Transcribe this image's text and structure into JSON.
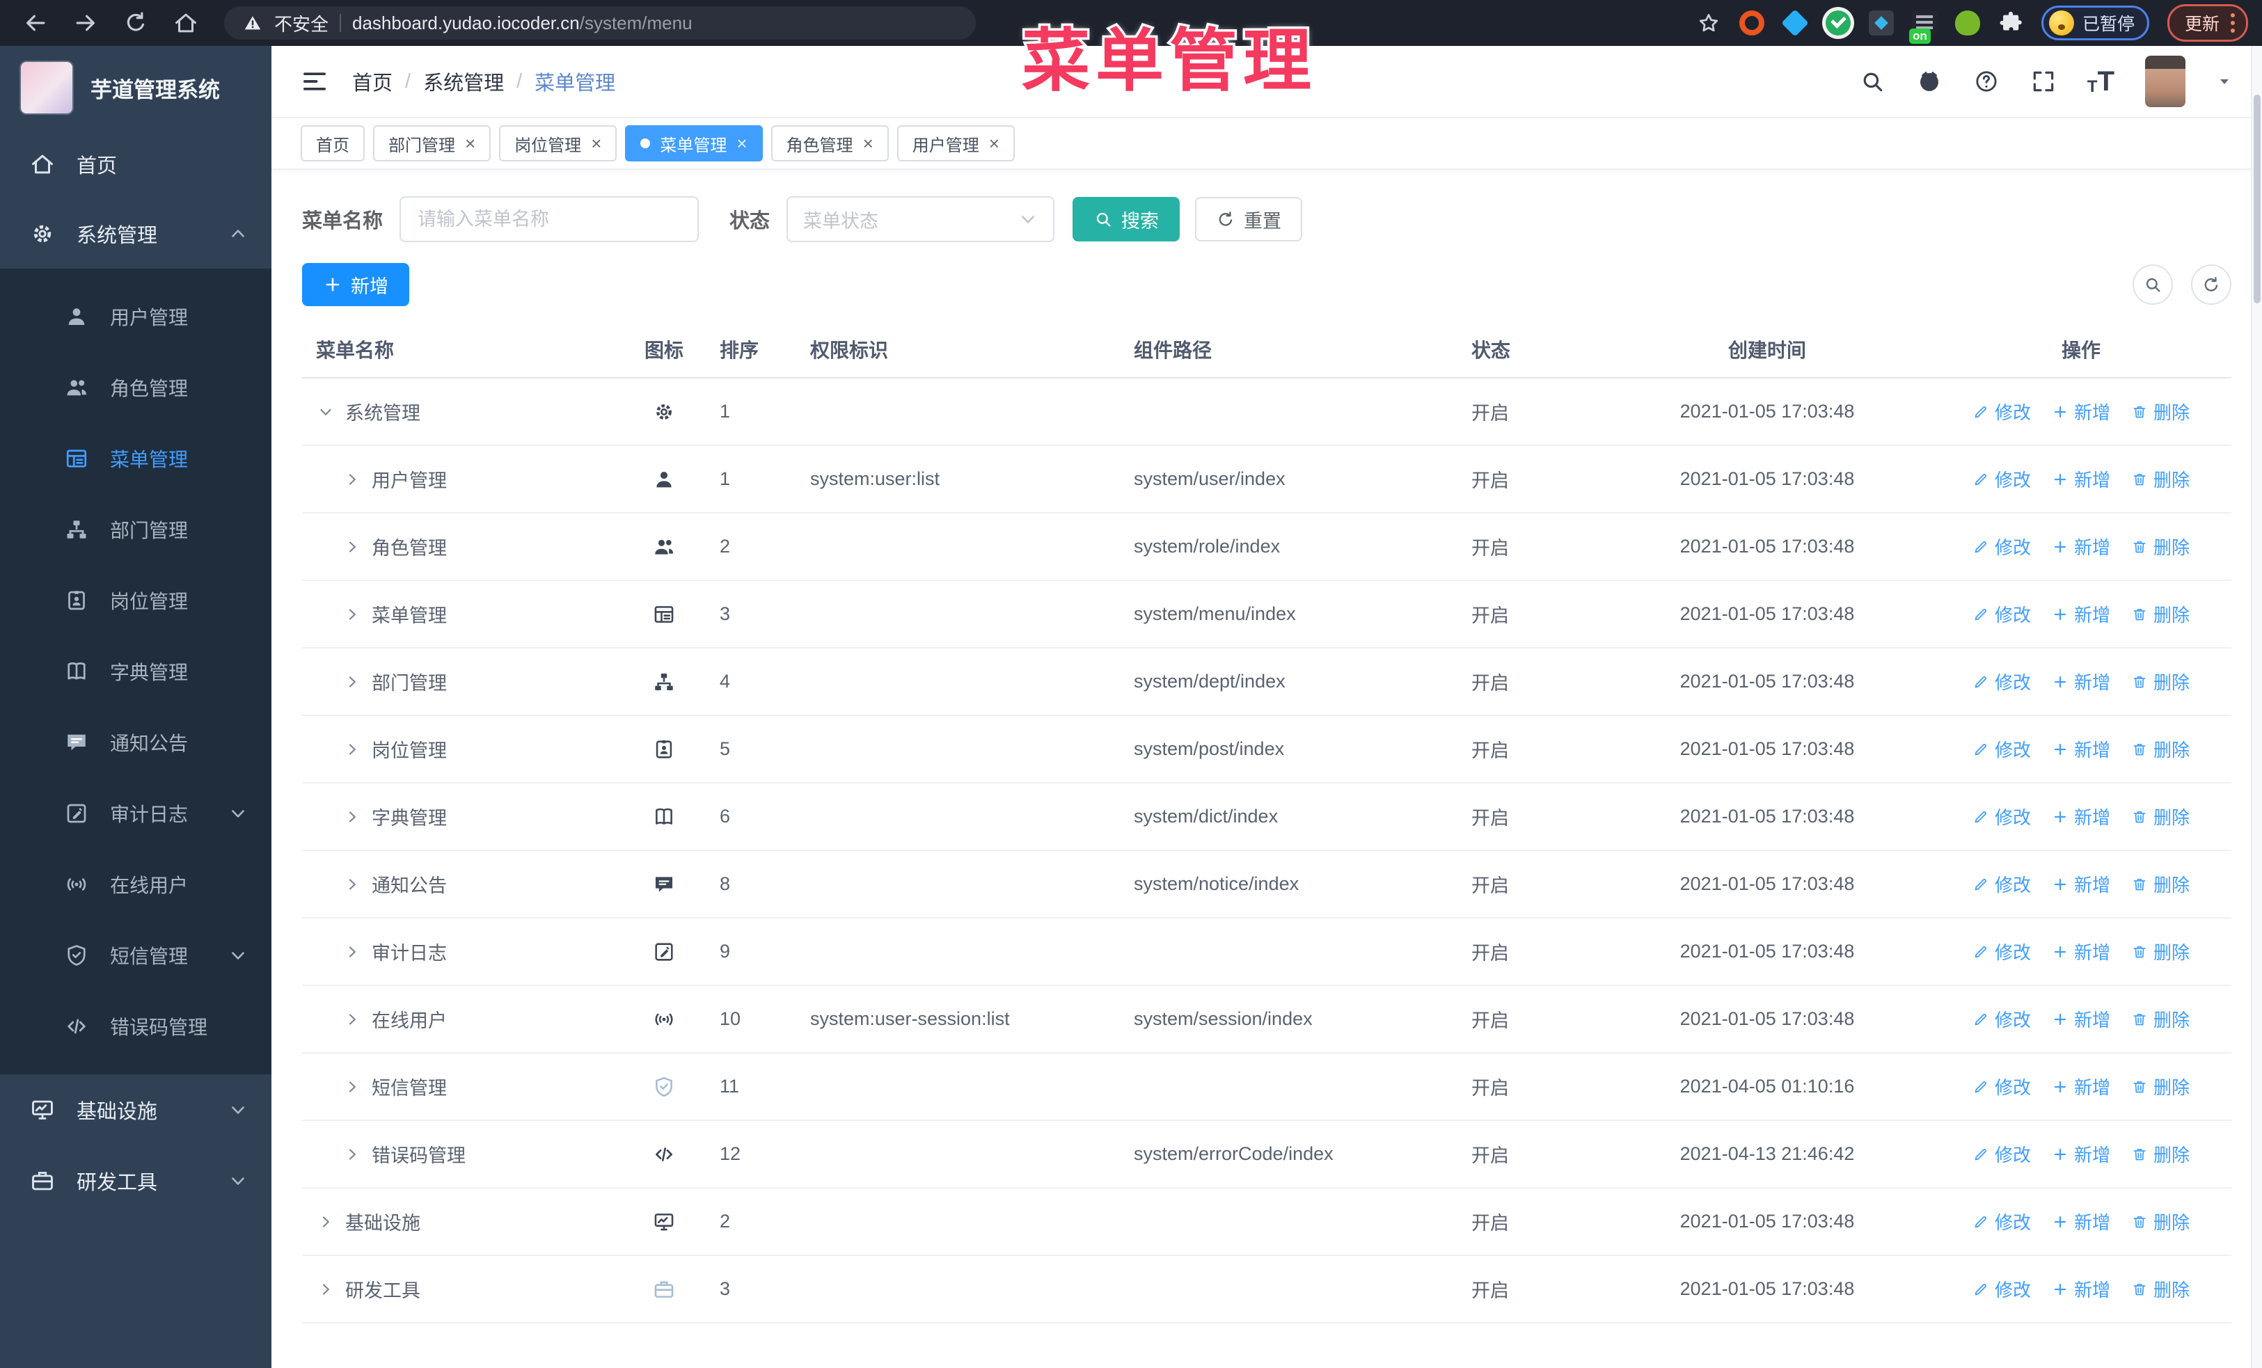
{
  "browser": {
    "security_label": "不安全",
    "url_host": "dashboard.yudao.iocoder.cn",
    "url_path": "/system/menu",
    "extension_on_badge": "on",
    "paused_label": "已暂停",
    "update_label": "更新"
  },
  "annotation": {
    "text": "菜单管理",
    "color": "#f43a5f"
  },
  "sidebar": {
    "app_title": "芋道管理系统",
    "items": [
      {
        "key": "home",
        "label": "首页",
        "icon": "home",
        "type": "top",
        "active": false,
        "chevron": ""
      },
      {
        "key": "system",
        "label": "系统管理",
        "icon": "gear",
        "type": "top",
        "active": false,
        "chevron": "up"
      },
      {
        "key": "user",
        "label": "用户管理",
        "icon": "user",
        "type": "sub",
        "active": false,
        "chevron": ""
      },
      {
        "key": "role",
        "label": "角色管理",
        "icon": "users",
        "type": "sub",
        "active": false,
        "chevron": ""
      },
      {
        "key": "menu",
        "label": "菜单管理",
        "icon": "menu",
        "type": "sub",
        "active": true,
        "chevron": ""
      },
      {
        "key": "dept",
        "label": "部门管理",
        "icon": "dept",
        "type": "sub",
        "active": false,
        "chevron": ""
      },
      {
        "key": "post",
        "label": "岗位管理",
        "icon": "post",
        "type": "sub",
        "active": false,
        "chevron": ""
      },
      {
        "key": "dict",
        "label": "字典管理",
        "icon": "dict",
        "type": "sub",
        "active": false,
        "chevron": ""
      },
      {
        "key": "notice",
        "label": "通知公告",
        "icon": "notice",
        "type": "sub",
        "active": false,
        "chevron": ""
      },
      {
        "key": "audit",
        "label": "审计日志",
        "icon": "audit",
        "type": "sub",
        "active": false,
        "chevron": "down"
      },
      {
        "key": "online",
        "label": "在线用户",
        "icon": "online",
        "type": "sub",
        "active": false,
        "chevron": ""
      },
      {
        "key": "sms",
        "label": "短信管理",
        "icon": "sms",
        "type": "sub",
        "active": false,
        "chevron": "down"
      },
      {
        "key": "errcode",
        "label": "错误码管理",
        "icon": "errcode",
        "type": "sub",
        "active": false,
        "chevron": ""
      },
      {
        "key": "infra",
        "label": "基础设施",
        "icon": "infra",
        "type": "tail",
        "active": false,
        "chevron": "down"
      },
      {
        "key": "devtool",
        "label": "研发工具",
        "icon": "devtool",
        "type": "tail",
        "active": false,
        "chevron": "down"
      }
    ]
  },
  "header": {
    "breadcrumbs": [
      "首页",
      "系统管理",
      "菜单管理"
    ]
  },
  "tabs": [
    {
      "key": "home",
      "label": "首页",
      "closable": false,
      "active": false
    },
    {
      "key": "dept",
      "label": "部门管理",
      "closable": true,
      "active": false
    },
    {
      "key": "post",
      "label": "岗位管理",
      "closable": true,
      "active": false
    },
    {
      "key": "menu",
      "label": "菜单管理",
      "closable": true,
      "active": true
    },
    {
      "key": "role",
      "label": "角色管理",
      "closable": true,
      "active": false
    },
    {
      "key": "user",
      "label": "用户管理",
      "closable": true,
      "active": false
    }
  ],
  "filters": {
    "name_label": "菜单名称",
    "name_placeholder": "请输入菜单名称",
    "name_value": "",
    "status_label": "状态",
    "status_placeholder": "菜单状态",
    "search_label": "搜索",
    "reset_label": "重置"
  },
  "toolbar": {
    "add_label": "新增"
  },
  "table": {
    "columns": [
      "菜单名称",
      "图标",
      "排序",
      "权限标识",
      "组件路径",
      "状态",
      "创建时间",
      "操作"
    ],
    "action_labels": {
      "edit": "修改",
      "add": "新增",
      "del": "删除"
    },
    "rows": [
      {
        "key": "system",
        "name": "系统管理",
        "level": 0,
        "expanded": true,
        "icon": "gear",
        "muted": false,
        "order": "1",
        "perm": "",
        "path": "",
        "status": "开启",
        "time": "2021-01-05 17:03:48"
      },
      {
        "key": "user",
        "name": "用户管理",
        "level": 1,
        "expanded": false,
        "icon": "user",
        "muted": false,
        "order": "1",
        "perm": "system:user:list",
        "path": "system/user/index",
        "status": "开启",
        "time": "2021-01-05 17:03:48"
      },
      {
        "key": "role",
        "name": "角色管理",
        "level": 1,
        "expanded": false,
        "icon": "users",
        "muted": false,
        "order": "2",
        "perm": "",
        "path": "system/role/index",
        "status": "开启",
        "time": "2021-01-05 17:03:48"
      },
      {
        "key": "menu",
        "name": "菜单管理",
        "level": 1,
        "expanded": false,
        "icon": "menu",
        "muted": false,
        "order": "3",
        "perm": "",
        "path": "system/menu/index",
        "status": "开启",
        "time": "2021-01-05 17:03:48"
      },
      {
        "key": "dept",
        "name": "部门管理",
        "level": 1,
        "expanded": false,
        "icon": "dept",
        "muted": false,
        "order": "4",
        "perm": "",
        "path": "system/dept/index",
        "status": "开启",
        "time": "2021-01-05 17:03:48"
      },
      {
        "key": "post",
        "name": "岗位管理",
        "level": 1,
        "expanded": false,
        "icon": "post",
        "muted": false,
        "order": "5",
        "perm": "",
        "path": "system/post/index",
        "status": "开启",
        "time": "2021-01-05 17:03:48"
      },
      {
        "key": "dict",
        "name": "字典管理",
        "level": 1,
        "expanded": false,
        "icon": "dict",
        "muted": false,
        "order": "6",
        "perm": "",
        "path": "system/dict/index",
        "status": "开启",
        "time": "2021-01-05 17:03:48"
      },
      {
        "key": "notice",
        "name": "通知公告",
        "level": 1,
        "expanded": false,
        "icon": "notice",
        "muted": false,
        "order": "8",
        "perm": "",
        "path": "system/notice/index",
        "status": "开启",
        "time": "2021-01-05 17:03:48"
      },
      {
        "key": "audit",
        "name": "审计日志",
        "level": 1,
        "expanded": false,
        "icon": "audit",
        "muted": false,
        "order": "9",
        "perm": "",
        "path": "",
        "status": "开启",
        "time": "2021-01-05 17:03:48"
      },
      {
        "key": "online",
        "name": "在线用户",
        "level": 1,
        "expanded": false,
        "icon": "online",
        "muted": false,
        "order": "10",
        "perm": "system:user-session:list",
        "path": "system/session/index",
        "status": "开启",
        "time": "2021-01-05 17:03:48"
      },
      {
        "key": "sms",
        "name": "短信管理",
        "level": 1,
        "expanded": false,
        "icon": "sms",
        "muted": true,
        "order": "11",
        "perm": "",
        "path": "",
        "status": "开启",
        "time": "2021-04-05 01:10:16"
      },
      {
        "key": "errcode",
        "name": "错误码管理",
        "level": 1,
        "expanded": false,
        "icon": "errcode",
        "muted": false,
        "order": "12",
        "perm": "",
        "path": "system/errorCode/index",
        "status": "开启",
        "time": "2021-04-13 21:46:42"
      },
      {
        "key": "infra",
        "name": "基础设施",
        "level": 0,
        "expanded": false,
        "icon": "infra",
        "muted": false,
        "order": "2",
        "perm": "",
        "path": "",
        "status": "开启",
        "time": "2021-01-05 17:03:48"
      },
      {
        "key": "devtool",
        "name": "研发工具",
        "level": 0,
        "expanded": false,
        "icon": "devtool",
        "muted": true,
        "order": "3",
        "perm": "",
        "path": "",
        "status": "开启",
        "time": "2021-01-05 17:03:48"
      }
    ]
  },
  "colors": {
    "accent": "#409eff",
    "primary_button": "#1890ff",
    "search_button": "#26b3a6",
    "annotation": "#f43a5f",
    "sidebar_bg": "#304156",
    "submenu_bg": "#1f2d3d",
    "tab_active_bg": "#409eff"
  }
}
